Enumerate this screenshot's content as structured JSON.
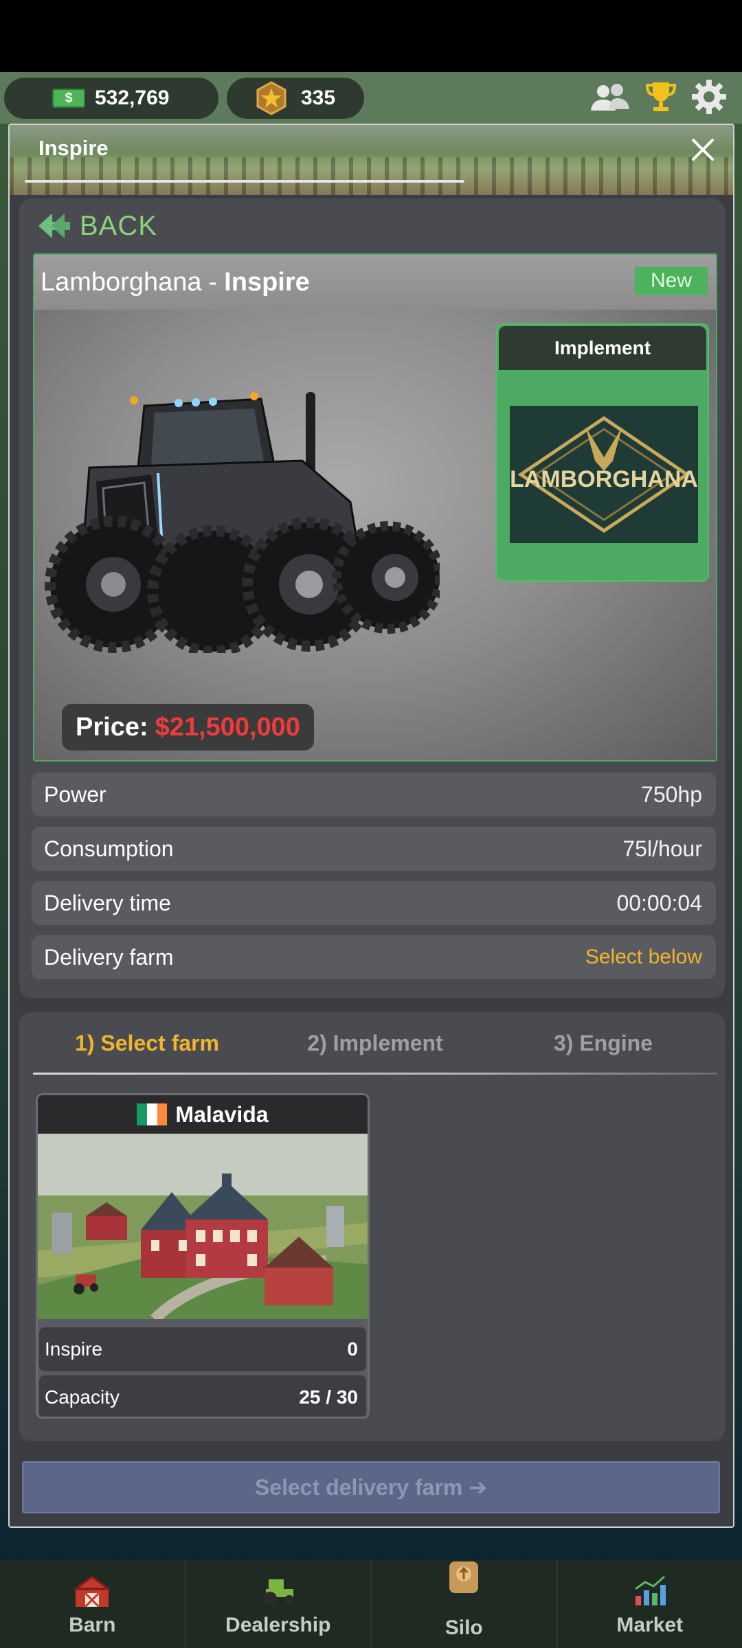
{
  "topbar": {
    "cash": "532,769",
    "stars": "335",
    "icons": [
      "friends-icon",
      "trophy-icon",
      "gear-icon"
    ]
  },
  "modal": {
    "title": "Inspire",
    "back_label": "BACK",
    "vehicle": {
      "brand": "Lamborghana",
      "separator": "-",
      "model": "Inspire",
      "badge": "New",
      "implement_label": "Implement",
      "implement_logo_text": "LAMBORGHANA",
      "price_label": "Price:",
      "price_value": "$21,500,000"
    },
    "specs": [
      {
        "label": "Power",
        "value": "750hp"
      },
      {
        "label": "Consumption",
        "value": "75l/hour"
      },
      {
        "label": "Delivery time",
        "value": "00:00:04"
      },
      {
        "label": "Delivery farm",
        "value": "Select below",
        "color": "#f0b42b"
      }
    ],
    "tabs": [
      {
        "label": "1) Select farm",
        "active": true
      },
      {
        "label": "2) Implement",
        "active": false
      },
      {
        "label": "3) Engine",
        "active": false
      }
    ],
    "farm": {
      "name": "Malavida",
      "flag": "ireland-flag",
      "rows": [
        {
          "label": "Inspire",
          "value": "0"
        },
        {
          "label": "Capacity",
          "value": "25 / 30"
        }
      ]
    },
    "cta_label": "Select delivery farm ➔"
  },
  "bottom_nav": [
    {
      "label": "Barn",
      "icon": "barn-icon"
    },
    {
      "label": "Dealership",
      "icon": "tractor-icon"
    },
    {
      "label": "Silo",
      "icon": "silo-icon"
    },
    {
      "label": "Market",
      "icon": "market-chart-icon"
    }
  ],
  "colors": {
    "accent_green": "#8cd27c",
    "badge_green": "#4cb35c",
    "price_red": "#ef3b3b",
    "active_tab": "#f0b42b",
    "cta_bg": "#5b6688"
  }
}
